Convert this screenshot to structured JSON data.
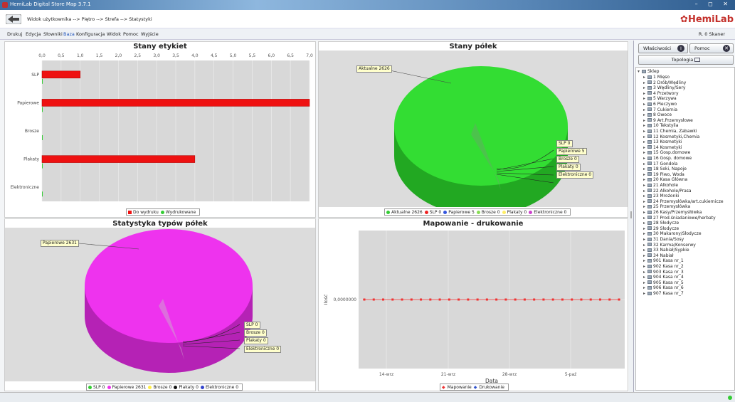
{
  "window": {
    "title": "HemiLab Digital Store Map 3.7.1",
    "controls": "– ◻ ✕"
  },
  "nav": {
    "breadcrumb": "Widok użytkownika --> Piętro --> Strefa --> Statystyki",
    "brand": "HemiLab",
    "back_icon": "back-arrow-icon"
  },
  "menu": {
    "items": [
      "Drukuj",
      "Edycja",
      "Słowniki",
      "Baza",
      "Konfiguracja",
      "Widok",
      "Pomoc",
      "Wyjście"
    ],
    "user": "R. 0   Skaner"
  },
  "charts": [
    {
      "type": "bar",
      "title": "Stany etykiet",
      "x_ticks": [
        "0,0",
        "0,5",
        "1,0",
        "1,5",
        "2,0",
        "2,5",
        "3,0",
        "3,5",
        "4,0",
        "4,5",
        "5,0",
        "5,5",
        "6,0",
        "6,5",
        "7,0"
      ],
      "categories": [
        "SLP",
        "Papierowe",
        "Brosze",
        "Plakaty",
        "Elektroniczne"
      ],
      "series": [
        {
          "name": "Do wydruku",
          "color": "#ee1111",
          "values": [
            1,
            7,
            0,
            4,
            0
          ]
        },
        {
          "name": "Wydrukowane",
          "color": "#33cc33",
          "values": [
            0,
            0,
            0,
            0,
            0
          ]
        }
      ],
      "xlim": [
        0,
        7
      ],
      "legend": "bottom"
    },
    {
      "type": "pie",
      "title": "Stany półek",
      "slices": [
        {
          "name": "Aktualne",
          "value": 2626,
          "color": "#33cc33"
        },
        {
          "name": "SLP",
          "value": 0,
          "color": "#ee2222"
        },
        {
          "name": "Papierowe",
          "value": 5,
          "color": "#3355dd"
        },
        {
          "name": "Brosze",
          "value": 0,
          "color": "#88dd55"
        },
        {
          "name": "Plakaty",
          "value": 0,
          "color": "#ffee66"
        },
        {
          "name": "Elektroniczne",
          "value": 0,
          "color": "#cc44cc"
        }
      ],
      "labels": {
        "main": "Aktualne 2626",
        "l1": "SLP 0",
        "l2": "Papierowe 5",
        "l3": "Brosze 0",
        "l4": "Plakaty 0",
        "l5": "Elektroniczne 0"
      },
      "legend_text": [
        "Aktualne 2626",
        "SLP 0",
        "Papierowe 5",
        "Brosze 0",
        "Plakaty 0",
        "Elektroniczne 0"
      ]
    },
    {
      "type": "pie",
      "title": "Statystyka typów półek",
      "slices": [
        {
          "name": "SLP",
          "value": 0,
          "color": "#33cc33"
        },
        {
          "name": "Papierowe",
          "value": 2631,
          "color": "#ee33ee"
        },
        {
          "name": "Brosze",
          "value": 0,
          "color": "#ffee44"
        },
        {
          "name": "Plakaty",
          "value": 0,
          "color": "#111111"
        },
        {
          "name": "Elektroniczne",
          "value": 0,
          "color": "#3344cc"
        }
      ],
      "labels": {
        "main": "Papierowe 2631",
        "l1": "SLP 0",
        "l2": "Brosze 0",
        "l3": "Plakaty 0",
        "l4": "Elektroniczne 0"
      },
      "legend_text": [
        "SLP 0",
        "Papierowe 2631",
        "Brosze 0",
        "Plakaty 0",
        "Elektroniczne 0"
      ]
    },
    {
      "type": "line",
      "title": "Mapowanie - drukowanie",
      "xlabel": "Data",
      "ylabel": "Ilość",
      "y_tick": "0,0000000",
      "x_ticks": [
        "14-wrz",
        "21-wrz",
        "28-wrz",
        "5-paź"
      ],
      "series": [
        {
          "name": "Mapowanie",
          "color": "#ee3333",
          "value": 0
        },
        {
          "name": "Drukowanie",
          "color": "#3355cc",
          "value": 0
        }
      ],
      "point_count": 28
    }
  ],
  "sidebar": {
    "buttons": {
      "properties": "Właściwości",
      "help": "Pomoc",
      "topology": "Topologia"
    },
    "root": "Sklep",
    "items": [
      "1 Mięso",
      "2 Drób/Wędliny",
      "3 Wędliny/Sery",
      "4 Przetwory",
      "5 Warzywa",
      "6 Pieczywo",
      "7 Cukiernia",
      "8 Owoce",
      "9 Art.Przemysłowe",
      "10 Tekstylia",
      "11 Chemia, Zabawki",
      "12 Kosmetyki,Chemia",
      "13 Kosmetyki",
      "14 Kosmetyki",
      "15 Gosp.domowe",
      "16 Gosp. domowe",
      "17 Gondola",
      "18 Soki, Napoje",
      "19 Piwo, Woda",
      "20 Kasa Główna",
      "21 Alkohole",
      "22 Alkohole/Prasa",
      "23 Mrożonki",
      "24 Przemysłówka/art.cukiernicze",
      "25 Przemysłówka",
      "26 Kasy/Przemysłówka",
      "27 Prod.śniadaniowe/herbaty",
      "28 Słodycze",
      "29 Słodycze",
      "30 Makarony/Słodycze",
      "31 Dania/Sosy",
      "32 Karma/Konserwy",
      "33 Nabiał/Sypkie",
      "34 Nabiał",
      "901 Kasa nr_1",
      "902 Kasa nr_2",
      "903 Kasa nr_3",
      "904 Kasa nr_4",
      "905 Kasa nr_5",
      "906 Kasa nr_6",
      "907 Kasa nr_7"
    ]
  }
}
